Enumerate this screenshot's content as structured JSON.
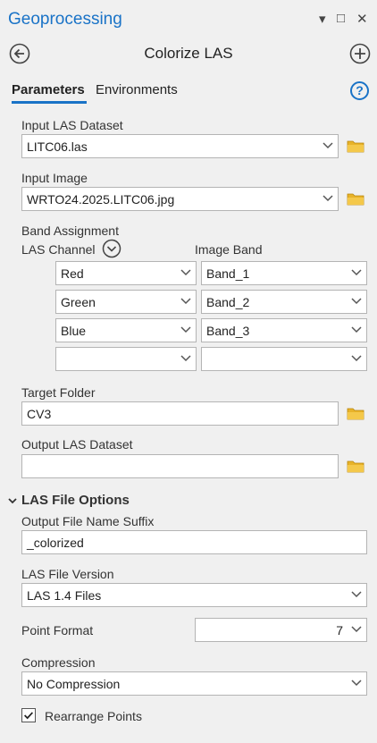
{
  "pane": {
    "title": "Geoprocessing",
    "ctrl_pin": "▾",
    "ctrl_max": "□",
    "ctrl_close": "✕"
  },
  "tool": {
    "title": "Colorize LAS"
  },
  "tabs": [
    {
      "label": "Parameters",
      "active": true
    },
    {
      "label": "Environments",
      "active": false
    }
  ],
  "help_glyph": "?",
  "params": {
    "input_las": {
      "label": "Input LAS Dataset",
      "value": "LITC06.las"
    },
    "input_image": {
      "label": "Input Image",
      "value": "WRTO24.2025.LITC06.jpg"
    },
    "band_assignment": {
      "label": "Band Assignment",
      "col_channel": "LAS Channel",
      "col_band": "Image Band",
      "rows": [
        {
          "channel": "Red",
          "band": "Band_1"
        },
        {
          "channel": "Green",
          "band": "Band_2"
        },
        {
          "channel": "Blue",
          "band": "Band_3"
        },
        {
          "channel": "",
          "band": ""
        }
      ]
    },
    "target_folder": {
      "label": "Target Folder",
      "value": "CV3"
    },
    "output_las": {
      "label": "Output LAS Dataset",
      "value": ""
    }
  },
  "las_options": {
    "section_label": "LAS File Options",
    "suffix": {
      "label": "Output File Name Suffix",
      "value": "_colorized"
    },
    "version": {
      "label": "LAS File Version",
      "value": "LAS 1.4 Files"
    },
    "point_format": {
      "label": "Point Format",
      "value": "7"
    },
    "compression": {
      "label": "Compression",
      "value": "No Compression"
    },
    "rearrange": {
      "label": "Rearrange Points",
      "checked": true
    }
  },
  "colors": {
    "accent": "#1a73c7",
    "folder": "#e8b32a"
  }
}
